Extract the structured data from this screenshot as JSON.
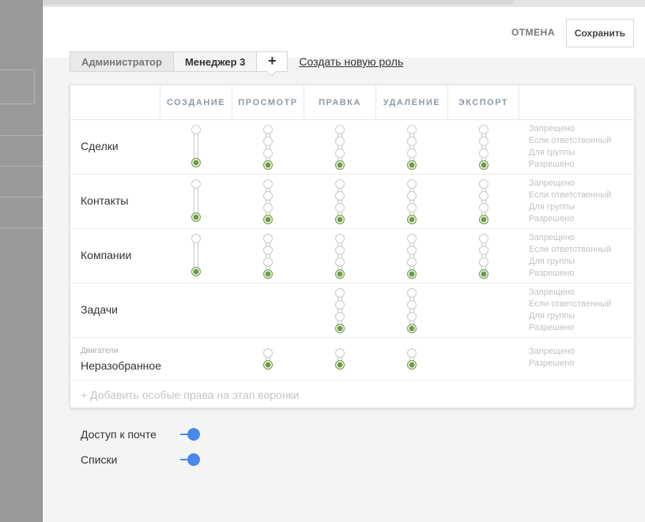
{
  "header": {
    "cancel_label": "ОТМЕНА",
    "save_label": "Сохранить"
  },
  "roles": {
    "tabs": [
      "Администратор",
      "Менеджер 3"
    ],
    "active_index": 1,
    "add_symbol": "+",
    "create_link": "Создать новую роль"
  },
  "table": {
    "columns": [
      "СОЗДАНИЕ",
      "ПРОСМОТР",
      "ПРАВКА",
      "УДАЛЕНИЕ",
      "ЭКСПОРТ"
    ],
    "legend_full": [
      "Запрещено",
      "Если ответственный",
      "Для группы",
      "Разрешено"
    ],
    "legend_short": [
      "Запрещено",
      "Разрешено"
    ],
    "rows": [
      {
        "label": "Сделки",
        "sub": ""
      },
      {
        "label": "Контакты",
        "sub": ""
      },
      {
        "label": "Компании",
        "sub": ""
      },
      {
        "label": "Задачи",
        "sub": ""
      },
      {
        "label": "Неразобранное",
        "sub": "Двигатели"
      }
    ],
    "add_stage_rights": "+ Добавить особые права на этап воронки"
  },
  "toggles": [
    {
      "label": "Доступ к почте",
      "on": true
    },
    {
      "label": "Списки",
      "on": true
    }
  ],
  "colors": {
    "allowed": "#6e9b47",
    "toggle": "#4a87e8"
  }
}
